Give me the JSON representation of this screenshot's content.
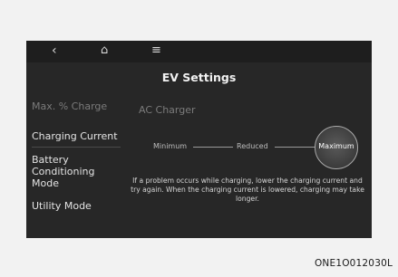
{
  "topbar": {
    "back_icon": "‹",
    "home_icon": "⌂",
    "menu_icon": "≡"
  },
  "title": "EV Settings",
  "sidebar": {
    "items": [
      {
        "label": "Max. % Charge"
      },
      {
        "label": "Charging Current"
      },
      {
        "label": "Battery Conditioning Mode"
      },
      {
        "label": "Utility Mode"
      }
    ]
  },
  "content": {
    "section_header": "AC Charger",
    "steps": [
      "Minimum",
      "Reduced",
      "Maximum"
    ],
    "selected_step": "Maximum",
    "note": "If a problem occurs while charging, lower the charging current and try again. When the charging current is lowered, charging may take longer."
  },
  "caption": "ONE1O012030L",
  "colors": {
    "screen_bg": "#272727",
    "text_primary": "#e4e4e4",
    "text_dim": "#7b7b7b"
  }
}
